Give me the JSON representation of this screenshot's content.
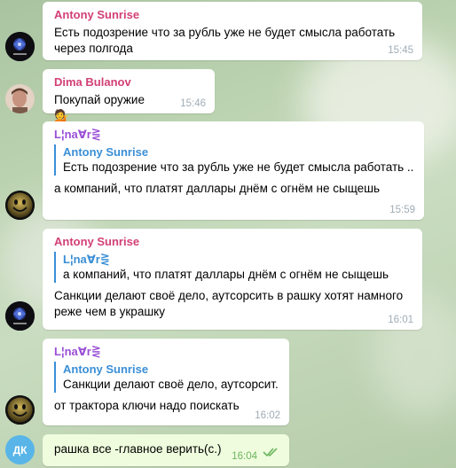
{
  "colors": {
    "antony": "#d23f75",
    "dima": "#d23f75",
    "lina": "#9b4fd6",
    "reply_accent": "#3a8fd6",
    "own_bubble": "#effdde",
    "read_check": "#6cb55f"
  },
  "messages": [
    {
      "sender": "Antony Sunrise",
      "text_lines": [
        "Есть подозрение что за рубль уже не будет смысла работать",
        "через полгода"
      ],
      "time": "15:45",
      "avatar_icon": "antony-avatar-icon"
    },
    {
      "sender": "Dima Bulanov",
      "text": "Покупай оружие",
      "emoji": "💁",
      "time": "15:46",
      "avatar_icon": "dima-avatar-icon"
    },
    {
      "sender": "L¦na∀r⋛",
      "reply": {
        "name": "Antony Sunrise",
        "text": "Есть подозрение что за рубль уже не будет смысла работать ..."
      },
      "text": "а компаний, что платят даллары днём с огнём не сыщешь",
      "time": "15:59",
      "avatar_icon": "smiley-avatar-icon"
    },
    {
      "sender": "Antony Sunrise",
      "reply": {
        "name": "L¦na∀r⋛",
        "text": "а компаний, что платят даллары днём с огнём не сыщешь"
      },
      "text_lines": [
        "Санкции делают своё дело, аутсорсить в рашку хотят намного",
        "реже чем в украшку"
      ],
      "time": "16:01",
      "avatar_icon": "antony-avatar-icon"
    },
    {
      "sender": "L¦na∀r⋛",
      "reply": {
        "name": "Antony Sunrise",
        "text": "Санкции делают своё дело, аутсорсит..."
      },
      "text": "от трактора ключи надо поискать",
      "time": "16:02",
      "avatar_icon": "smiley-avatar-icon"
    },
    {
      "avatar_initials": "ДК",
      "text": "рашка все -главное верить(с.)",
      "time": "16:04",
      "status_icon": "double-check-icon"
    }
  ]
}
